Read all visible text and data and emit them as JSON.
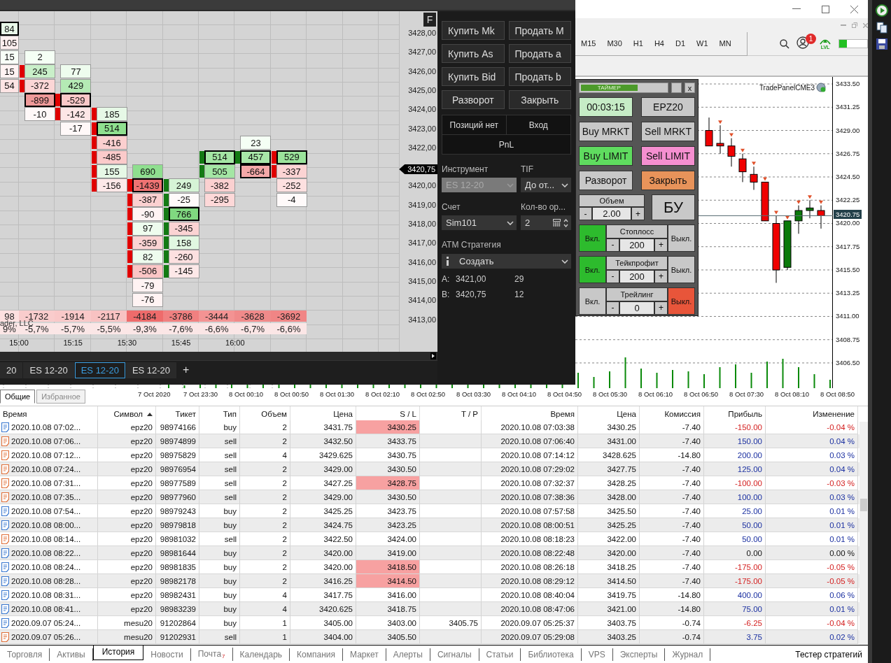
{
  "ninja": {
    "chart": {
      "panel_button": "F",
      "copyright": "ader, LLC",
      "last_price": "3420,75",
      "price_labels_upper": [
        "3428,00",
        "3427,00",
        "3426,00",
        "3425,00",
        "3424,00",
        "3423,00",
        "3422,00"
      ],
      "price_labels_lower": [
        "3420,00",
        "3419,00",
        "3418,00",
        "3417,00",
        "3416,00",
        "3415,00",
        "3414,00",
        "3413,00"
      ],
      "time_labels": [
        "15:00",
        "15:15",
        "15:30",
        "15:45",
        "16:00"
      ],
      "columns": [
        {
          "delta": {
            "text": "98",
            "color": "#fde0e0"
          },
          "percent": "9%",
          "cells": [
            {
              "text": "84",
              "color": "#e9fae9",
              "max": true
            },
            {
              "text": "105",
              "color": "#fff0f0",
              "max": false
            },
            {
              "text": "15",
              "color": "#f8fff8",
              "max": false
            },
            {
              "text": "15",
              "color": "#fff3f3",
              "max": false
            },
            {
              "text": "54",
              "color": "#fde4e4",
              "max": false
            }
          ]
        },
        {
          "kind": "down",
          "delta": {
            "text": "-1732",
            "color": "#f9cccc"
          },
          "percent": "-5,7%",
          "cells": [
            {
              "text": "2",
              "color": "#f5fff5",
              "max": false,
              "body": false
            },
            {
              "text": "245",
              "color": "#c9efc9",
              "max": false,
              "body": true
            },
            {
              "text": "-372",
              "color": "#fbd6d6",
              "max": false,
              "body": true
            },
            {
              "text": "-899",
              "color": "#ee9999",
              "max": true,
              "body": false
            },
            {
              "text": "-10",
              "color": "#fff8f8",
              "max": false,
              "body": false
            }
          ]
        },
        {
          "kind": "down",
          "delta": {
            "text": "-1914",
            "color": "#f9c8c8"
          },
          "percent": "-5,7%",
          "cells": [
            {
              "text": "77",
              "color": "#eefcee",
              "max": false,
              "body": false
            },
            {
              "text": "429",
              "color": "#b4eab4",
              "max": false,
              "body": false
            },
            {
              "text": "-529",
              "color": "#fbc8c8",
              "max": true,
              "body": true
            },
            {
              "text": "-142",
              "color": "#fde6e6",
              "max": false,
              "body": true
            },
            {
              "text": "-17",
              "color": "#fff8f8",
              "max": false,
              "body": false
            }
          ]
        },
        {
          "kind": "down",
          "delta": {
            "text": "-2117",
            "color": "#f8c2c2"
          },
          "percent": "-5,5%",
          "cells": [
            {
              "text": "185",
              "color": "#e6f8e6",
              "max": false,
              "body": true
            },
            {
              "text": "514",
              "color": "#8fdf8f",
              "max": true,
              "body": true
            },
            {
              "text": "-416",
              "color": "#fbcfcf",
              "max": false,
              "body": true
            },
            {
              "text": "-485",
              "color": "#fbcaca",
              "max": false,
              "body": true
            },
            {
              "text": "155",
              "color": "#e6f8e6",
              "max": false,
              "body": true
            },
            {
              "text": "-156",
              "color": "#fde8e8",
              "max": false,
              "body": true
            }
          ]
        },
        {
          "kind": "down",
          "delta": {
            "text": "-4184",
            "color": "#ee6b6b"
          },
          "percent": "-9,3%",
          "cells": [
            {
              "text": "690",
              "color": "#8fdf8f",
              "max": false,
              "body": false
            },
            {
              "text": "-1439",
              "color": "#ee7272",
              "max": true,
              "body": true
            },
            {
              "text": "-387",
              "color": "#fbd0d0",
              "max": false,
              "body": true
            },
            {
              "text": "-90",
              "color": "#fff3f3",
              "max": false,
              "body": true
            },
            {
              "text": "97",
              "color": "#eefcee",
              "max": false,
              "body": true
            },
            {
              "text": "-359",
              "color": "#fbd3d3",
              "max": false,
              "body": true
            },
            {
              "text": "82",
              "color": "#eefcee",
              "max": false,
              "body": true
            },
            {
              "text": "-506",
              "color": "#fbc5c5",
              "max": false,
              "body": true
            },
            {
              "text": "-79",
              "color": "#fff3f3",
              "max": false,
              "body": false
            },
            {
              "text": "-76",
              "color": "#fff3f3",
              "max": false,
              "body": false
            }
          ]
        },
        {
          "kind": "up",
          "delta": {
            "text": "-3786",
            "color": "#f08080"
          },
          "percent": "-7,6%",
          "cells": [
            {
              "text": "249",
              "color": "#d6f4d6",
              "max": false,
              "body": true
            },
            {
              "text": "-25",
              "color": "#fffafa",
              "max": false,
              "body": true
            },
            {
              "text": "766",
              "color": "#80d880",
              "max": true,
              "body": true
            },
            {
              "text": "-345",
              "color": "#fbd3d3",
              "max": false,
              "body": true
            },
            {
              "text": "158",
              "color": "#e1f7e1",
              "max": false,
              "body": true
            },
            {
              "text": "-260",
              "color": "#fde0e0",
              "max": false,
              "body": true
            },
            {
              "text": "-145",
              "color": "#fde8e8",
              "max": false,
              "body": true
            }
          ]
        },
        {
          "kind": "up",
          "delta": {
            "text": "-3444",
            "color": "#f39393"
          },
          "percent": "-6,6%",
          "cells": [
            {
              "text": "514",
              "color": "#a4e6a4",
              "max": true,
              "body": true
            },
            {
              "text": "505",
              "color": "#a4e6a4",
              "max": false,
              "body": true
            },
            {
              "text": "-382",
              "color": "#fbd0d0",
              "max": false,
              "body": false
            },
            {
              "text": "-295",
              "color": "#fdd8d8",
              "max": false,
              "body": false
            }
          ]
        },
        {
          "kind": "up",
          "delta": {
            "text": "-3628",
            "color": "#f08a8a"
          },
          "percent": "-6,7%",
          "cells": [
            {
              "text": "23",
              "color": "#f5fff5",
              "max": false,
              "body": false
            },
            {
              "text": "457",
              "color": "#a8e6a8",
              "max": true,
              "body": true
            },
            {
              "text": "-664",
              "color": "#f4a8a8",
              "max": true,
              "body": false
            }
          ]
        },
        {
          "kind": "down",
          "delta": {
            "text": "-3692",
            "color": "#f08585"
          },
          "percent": "-6,6%",
          "cells": [
            {
              "text": "529",
              "color": "#9be39b",
              "max": true,
              "body": true
            },
            {
              "text": "-337",
              "color": "#fbd3d3",
              "max": false,
              "body": true
            },
            {
              "text": "-252",
              "color": "#fde0e0",
              "max": false,
              "body": false
            },
            {
              "text": "-4",
              "color": "#fffafa",
              "max": false,
              "body": false
            }
          ]
        }
      ]
    },
    "order_buttons": [
      "Купить Mk",
      "Продать M",
      "Купить As",
      "Продать a",
      "Купить Bid",
      "Продать b",
      "Разворот",
      "Закрыть"
    ],
    "position": {
      "status": "Позиций нет",
      "entry": "Вход",
      "pnl": "PnL"
    },
    "instrument": {
      "label": "Инструмент",
      "value": "ES 12-20",
      "disabled": true
    },
    "tif": {
      "label": "TIF",
      "value": "До от..."
    },
    "account": {
      "label": "Счет",
      "value": "Sim101"
    },
    "quantity": {
      "label": "Кол-во ор...",
      "value": "2"
    },
    "atm": {
      "label": "ATM Стратегия",
      "value": "Создать"
    },
    "quotes": [
      {
        "side": "A:",
        "price": "3421,00",
        "size": "29"
      },
      {
        "side": "B:",
        "price": "3420,75",
        "size": "12"
      }
    ],
    "tabs": [
      {
        "label": "20",
        "selected": false
      },
      {
        "label": "ES 12-20",
        "selected": false
      },
      {
        "label": "ES 12-20",
        "selected": true
      },
      {
        "label": "ES 12-20",
        "selected": false
      }
    ],
    "add_tab": "+"
  },
  "mt": {
    "timeframes": [
      "M15",
      "M30",
      "H1",
      "H4",
      "D1",
      "W1",
      "MN"
    ],
    "notification_count": "1",
    "lvl_label": "LVL",
    "status_meter": {
      "level": 0.28
    },
    "chart_label": "TradePanelCME3",
    "last_price": "3420.75",
    "chart_data": {
      "type": "candlestick",
      "grid": true,
      "ylim": [
        3404.06,
        3434.18
      ],
      "categories": [
        null,
        null,
        null,
        null,
        null,
        null,
        null,
        null,
        null,
        null,
        null
      ],
      "yticks": [
        {
          "value": 3433.5,
          "label": "3433.50"
        },
        {
          "value": 3431.25,
          "label": "3431.25"
        },
        {
          "value": 3429,
          "label": "3429.00"
        },
        {
          "value": 3426.75,
          "label": "3426.75"
        },
        {
          "value": 3424.5,
          "label": "3424.50"
        },
        {
          "value": 3422.25,
          "label": "3422.25"
        },
        {
          "value": 3420,
          "label": "3420.00"
        },
        {
          "value": 3417.75,
          "label": "3417.75"
        },
        {
          "value": 3415.5,
          "label": "3415.50"
        },
        {
          "value": 3413.25,
          "label": "3413.25"
        },
        {
          "value": 3411,
          "label": "3411.00"
        },
        {
          "value": 3408.75,
          "label": "3408.75"
        },
        {
          "value": 3406.5,
          "label": "3406.50"
        }
      ],
      "ohlc": [
        [
          3429.0,
          3430.25,
          3427.5,
          3427.5
        ],
        [
          3427.75,
          3429.5,
          3426.75,
          3427.5
        ],
        [
          3427.5,
          3428.25,
          3425.5,
          3426.5
        ],
        [
          3426.25,
          3426.75,
          3424.0,
          3425.0
        ],
        [
          3424.75,
          3425.5,
          3423.25,
          3424.0
        ],
        [
          3424.0,
          3424.0,
          3420.25,
          3420.25
        ],
        [
          3420.0,
          3420.75,
          3414.25,
          3415.5
        ],
        [
          3415.75,
          3420.25,
          3415.5,
          3420.25
        ],
        [
          3420.25,
          3421.75,
          3419.0,
          3421.25
        ],
        [
          3421.25,
          3422.25,
          3420.5,
          3421.5
        ],
        [
          3421.25,
          3421.75,
          3419.5,
          3420.75
        ]
      ]
    },
    "time_labels": [
      "7 Oct 2020",
      "7 Oct 23:30",
      "8 Oct 00:10",
      "8 Oct 00:50",
      "8 Oct 01:30",
      "8 Oct 02:10",
      "8 Oct 02:50",
      "8 Oct 03:30",
      "8 Oct 04:10",
      "8 Oct 04:50",
      "8 Oct 05:30",
      "8 Oct 06:10",
      "8 Oct 06:50",
      "8 Oct 07:30",
      "8 Oct 08:10",
      "8 Oct 08:50"
    ],
    "trade_panel": {
      "timer": {
        "label": "ТАЙМЕР",
        "level": 0.66
      },
      "close": "x",
      "buttons": [
        {
          "label": "00:03:15",
          "color": "#c6ecc6"
        },
        {
          "label": "EPZ20",
          "color": "#c8c8c8"
        },
        {
          "label": "Buy MRKT",
          "color": "#c8c8c8"
        },
        {
          "label": "Sell MRKT",
          "color": "#c8c8c8"
        },
        {
          "label": "Buy LIMIT",
          "color": "#5fdc5f"
        },
        {
          "label": "Sell LIMIT",
          "color": "#f58fd0"
        },
        {
          "label": "Разворот",
          "color": "#c8c8c8"
        },
        {
          "label": "Закрыть",
          "color": "#e8935a"
        }
      ],
      "volume": {
        "label": "Объем",
        "minus": "-",
        "value": "2.00",
        "plus": "+"
      },
      "breakeven": "БУ",
      "toggles": [
        {
          "label": "Стоплосс",
          "on_label": "Вкл.",
          "off_label": "Выкл.",
          "on": true,
          "minus": "-",
          "value": "200",
          "plus": "+"
        },
        {
          "label": "Тейкпрофит",
          "on_label": "Вкл.",
          "off_label": "Выкл.",
          "on": true,
          "minus": "-",
          "value": "200",
          "plus": "+"
        },
        {
          "label": "Трейлинг",
          "on_label": "Вкл.",
          "off_label": "Выкл.",
          "on": false,
          "minus": "-",
          "value": "0",
          "plus": "+"
        }
      ]
    },
    "navigator_tabs": [
      {
        "label": "Общие",
        "selected": true
      },
      {
        "label": "Избранное",
        "selected": false
      }
    ],
    "table": {
      "columns": [
        "Время",
        "Символ",
        "Тикет",
        "Тип",
        "Объем",
        "Цена",
        "S / L",
        "T / P",
        "Время",
        "Цена",
        "Комиссия",
        "Прибыль",
        "Изменение"
      ],
      "rows": [
        {
          "kind": "buy",
          "time": "2020.10.08 07:02...",
          "symbol": "epz20",
          "ticket": "98974166",
          "type": "buy",
          "volume": "2",
          "price": "3431.75",
          "sl": "3430.25",
          "sl_hit": true,
          "close_time": "2020.10.08 07:03:38",
          "close_price": "3430.25",
          "commission": "-7.40",
          "profit": "-150.00",
          "change": "-0.04 %",
          "color": "#d42020"
        },
        {
          "kind": "sell",
          "time": "2020.10.08 07:06...",
          "symbol": "epz20",
          "ticket": "98974899",
          "type": "sell",
          "volume": "2",
          "price": "3432.50",
          "sl": "3433.75",
          "sl_hit": false,
          "close_time": "2020.10.08 07:06:40",
          "close_price": "3431.00",
          "commission": "-7.40",
          "profit": "150.00",
          "change": "0.04 %",
          "color": "#1a2fa0"
        },
        {
          "kind": "sell",
          "time": "2020.10.08 07:12...",
          "symbol": "epz20",
          "ticket": "98975829",
          "type": "sell",
          "volume": "4",
          "price": "3429.625",
          "sl": "3430.75",
          "sl_hit": false,
          "close_time": "2020.10.08 07:14:12",
          "close_price": "3428.625",
          "commission": "-14.80",
          "profit": "200.00",
          "change": "0.03 %",
          "color": "#1a2fa0"
        },
        {
          "kind": "sell",
          "time": "2020.10.08 07:24...",
          "symbol": "epz20",
          "ticket": "98976954",
          "type": "sell",
          "volume": "2",
          "price": "3429.00",
          "sl": "3430.50",
          "sl_hit": false,
          "close_time": "2020.10.08 07:29:02",
          "close_price": "3427.75",
          "commission": "-7.40",
          "profit": "125.00",
          "change": "0.04 %",
          "color": "#1a2fa0"
        },
        {
          "kind": "sell",
          "time": "2020.10.08 07:31...",
          "symbol": "epz20",
          "ticket": "98977589",
          "type": "sell",
          "volume": "2",
          "price": "3427.25",
          "sl": "3428.75",
          "sl_hit": true,
          "close_time": "2020.10.08 07:32:37",
          "close_price": "3428.25",
          "commission": "-7.40",
          "profit": "-100.00",
          "change": "-0.03 %",
          "color": "#d42020"
        },
        {
          "kind": "sell",
          "time": "2020.10.08 07:35...",
          "symbol": "epz20",
          "ticket": "98977960",
          "type": "sell",
          "volume": "2",
          "price": "3429.00",
          "sl": "3430.50",
          "sl_hit": false,
          "close_time": "2020.10.08 07:38:36",
          "close_price": "3428.00",
          "commission": "-7.40",
          "profit": "100.00",
          "change": "0.03 %",
          "color": "#1a2fa0"
        },
        {
          "kind": "buy",
          "time": "2020.10.08 07:54...",
          "symbol": "epz20",
          "ticket": "98979243",
          "type": "buy",
          "volume": "2",
          "price": "3425.25",
          "sl": "3423.75",
          "sl_hit": false,
          "close_time": "2020.10.08 07:57:58",
          "close_price": "3425.50",
          "commission": "-7.40",
          "profit": "25.00",
          "change": "0.01 %",
          "color": "#1a2fa0"
        },
        {
          "kind": "buy",
          "time": "2020.10.08 08:00...",
          "symbol": "epz20",
          "ticket": "98979818",
          "type": "buy",
          "volume": "2",
          "price": "3424.75",
          "sl": "3423.25",
          "sl_hit": false,
          "close_time": "2020.10.08 08:00:51",
          "close_price": "3425.25",
          "commission": "-7.40",
          "profit": "50.00",
          "change": "0.01 %",
          "color": "#1a2fa0"
        },
        {
          "kind": "sell",
          "time": "2020.10.08 08:14...",
          "symbol": "epz20",
          "ticket": "98981032",
          "type": "sell",
          "volume": "2",
          "price": "3422.50",
          "sl": "3424.00",
          "sl_hit": false,
          "close_time": "2020.10.08 08:18:23",
          "close_price": "3422.00",
          "commission": "-7.40",
          "profit": "50.00",
          "change": "0.01 %",
          "color": "#1a2fa0"
        },
        {
          "kind": "buy",
          "time": "2020.10.08 08:22...",
          "symbol": "epz20",
          "ticket": "98981644",
          "type": "buy",
          "volume": "2",
          "price": "3420.00",
          "sl": "3419.00",
          "sl_hit": false,
          "close_time": "2020.10.08 08:22:48",
          "close_price": "3420.00",
          "commission": "-7.40",
          "profit": "0.00",
          "change": "0.00 %",
          "color": "#111111"
        },
        {
          "kind": "buy",
          "time": "2020.10.08 08:24...",
          "symbol": "epz20",
          "ticket": "98981835",
          "type": "buy",
          "volume": "2",
          "price": "3420.00",
          "sl": "3418.50",
          "sl_hit": true,
          "close_time": "2020.10.08 08:26:18",
          "close_price": "3418.25",
          "commission": "-7.40",
          "profit": "-175.00",
          "change": "-0.05 %",
          "color": "#d42020"
        },
        {
          "kind": "buy",
          "time": "2020.10.08 08:28...",
          "symbol": "epz20",
          "ticket": "98982178",
          "type": "buy",
          "volume": "2",
          "price": "3416.25",
          "sl": "3414.50",
          "sl_hit": true,
          "close_time": "2020.10.08 08:29:12",
          "close_price": "3414.50",
          "commission": "-7.40",
          "profit": "-175.00",
          "change": "-0.05 %",
          "color": "#d42020"
        },
        {
          "kind": "buy",
          "time": "2020.10.08 08:31...",
          "symbol": "epz20",
          "ticket": "98982431",
          "type": "buy",
          "volume": "4",
          "price": "3417.75",
          "sl": "3416.00",
          "sl_hit": false,
          "close_time": "2020.10.08 08:40:04",
          "close_price": "3419.75",
          "commission": "-14.80",
          "profit": "400.00",
          "change": "0.06 %",
          "color": "#1a2fa0"
        },
        {
          "kind": "buy",
          "time": "2020.10.08 08:41...",
          "symbol": "epz20",
          "ticket": "98983239",
          "type": "buy",
          "volume": "4",
          "price": "3420.625",
          "sl": "3418.75",
          "sl_hit": false,
          "close_time": "2020.10.08 08:47:06",
          "close_price": "3421.00",
          "commission": "-14.80",
          "profit": "75.00",
          "change": "0.01 %",
          "color": "#1a2fa0"
        },
        {
          "kind": "buy",
          "time": "2020.09.07 05:24...",
          "symbol": "mesu20",
          "ticket": "91202864",
          "type": "buy",
          "volume": "1",
          "price": "3405.00",
          "sl": "3403.00",
          "sl_hit": false,
          "tp": "3405.75",
          "close_time": "2020.09.07 05:25:37",
          "close_price": "3403.75",
          "commission": "-0.74",
          "profit": "-6.25",
          "change": "-0.04 %",
          "color": "#d42020"
        },
        {
          "kind": "sell",
          "time": "2020.09.07 05:26...",
          "symbol": "mesu20",
          "ticket": "91202931",
          "type": "sell",
          "volume": "1",
          "price": "3404.00",
          "sl": "3405.50",
          "sl_hit": false,
          "close_time": "2020.09.07 05:29:08",
          "close_price": "3403.25",
          "commission": "-0.74",
          "profit": "3.75",
          "change": "0.02 %",
          "color": "#1a2fa0"
        }
      ]
    },
    "bottom_tabs": [
      {
        "label": "Торговля",
        "selected": false
      },
      {
        "label": "Активы",
        "selected": false
      },
      {
        "label": "История",
        "selected": true
      },
      {
        "label": "Новости",
        "selected": false
      },
      {
        "label": "Почта",
        "selected": false,
        "badge": "7"
      },
      {
        "label": "Календарь",
        "selected": false
      },
      {
        "label": "Компания",
        "selected": false
      },
      {
        "label": "Маркет",
        "selected": false
      },
      {
        "label": "Алерты",
        "selected": false
      },
      {
        "label": "Сигналы",
        "selected": false
      },
      {
        "label": "Статьи",
        "selected": false
      },
      {
        "label": "Библиотека",
        "selected": false
      },
      {
        "label": "VPS",
        "selected": false
      },
      {
        "label": "Эксперты",
        "selected": false
      },
      {
        "label": "Журнал",
        "selected": false
      }
    ],
    "tester_tab": "Тестер стратегий"
  }
}
